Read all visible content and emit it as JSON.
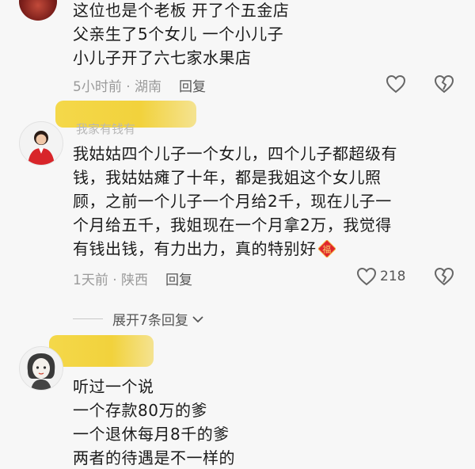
{
  "comment1": {
    "lines": [
      "这位也是个老板 开了个五金店",
      "父亲生了5个女儿 一个小儿子",
      "小儿子开了六七家水果店"
    ],
    "meta": "5小时前 · 湖南",
    "reply_label": "回复"
  },
  "comment2": {
    "username_hint": "我家有钱有",
    "lines": [
      "我姑姑四个儿子一个女儿，四个儿子都超级有",
      "钱，我姑姑瘫了十年，都是我姐这个女儿照",
      "顾，之前一个儿子一个月给2千，现在儿子一",
      "个月给五千，我姐现在一个月拿2万，我觉得",
      "有钱出钱，有力出力，真的特别好"
    ],
    "emoji_char": "福",
    "meta": "1天前 · 陕西",
    "reply_label": "回复",
    "like_count": "218"
  },
  "expand_replies": {
    "label": "展开7条回复"
  },
  "comment3": {
    "lines": [
      "听过一个说",
      "一个存款80万的爹",
      "一个退休每月8千的爹",
      "两者的待遇是不一样的"
    ]
  },
  "colors": {
    "redaction": "#f2d23c",
    "emoji_red": "#e0262b",
    "meta_gray": "#9a9a9a"
  },
  "icons": [
    "heart-outline-icon",
    "broken-heart-icon",
    "chevron-down-icon"
  ]
}
